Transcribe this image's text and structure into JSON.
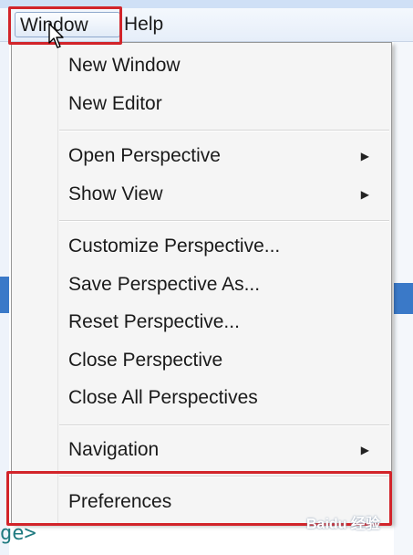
{
  "menubar": {
    "window_label": "Window",
    "help_label": "Help"
  },
  "window_menu": {
    "items": [
      {
        "label": "New Window"
      },
      {
        "label": "New Editor"
      },
      {
        "label": "Open Perspective",
        "submenu": true
      },
      {
        "label": "Show View",
        "submenu": true
      },
      {
        "label": "Customize Perspective..."
      },
      {
        "label": "Save Perspective As..."
      },
      {
        "label": "Reset Perspective..."
      },
      {
        "label": "Close Perspective"
      },
      {
        "label": "Close All Perspectives"
      },
      {
        "label": "Navigation",
        "submenu": true
      },
      {
        "label": "Preferences"
      }
    ]
  },
  "background": {
    "bottom_text": "ge>",
    "watermark": "Baidu 经验"
  },
  "colors": {
    "highlight": "#d2242a",
    "selection": "#3a79c8"
  },
  "icons": {
    "submenu_arrow": "chevron-right-icon",
    "cursor": "mouse-pointer-icon"
  }
}
